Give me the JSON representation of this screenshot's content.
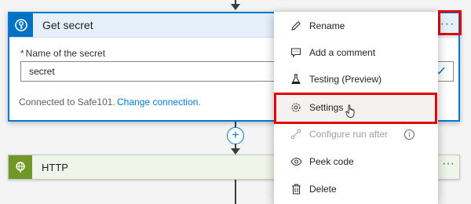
{
  "secret_card": {
    "title": "Get secret",
    "more_label": "···",
    "field_label": "Name of the secret",
    "required_mark": "*",
    "field_value": "secret",
    "connected_text": "Connected to Safe101.",
    "change_connection": "Change connection."
  },
  "add_step_label": "+",
  "http_card": {
    "title": "HTTP",
    "more_label": "···"
  },
  "menu": {
    "items": [
      {
        "label": "Rename",
        "icon": "pencil-icon"
      },
      {
        "label": "Add a comment",
        "icon": "comment-icon"
      },
      {
        "label": "Testing (Preview)",
        "icon": "flask-icon"
      },
      {
        "label": "Settings",
        "icon": "gear-icon"
      },
      {
        "label": "Configure run after",
        "icon": "run-after-icon"
      },
      {
        "label": "Peek code",
        "icon": "eye-icon"
      },
      {
        "label": "Delete",
        "icon": "trash-icon"
      }
    ],
    "info_glyph": "i"
  },
  "colors": {
    "accent": "#0078d4",
    "keyvault_icon_bg": "#0072c6",
    "http_icon_bg": "#709727",
    "highlight": "#e00000"
  }
}
